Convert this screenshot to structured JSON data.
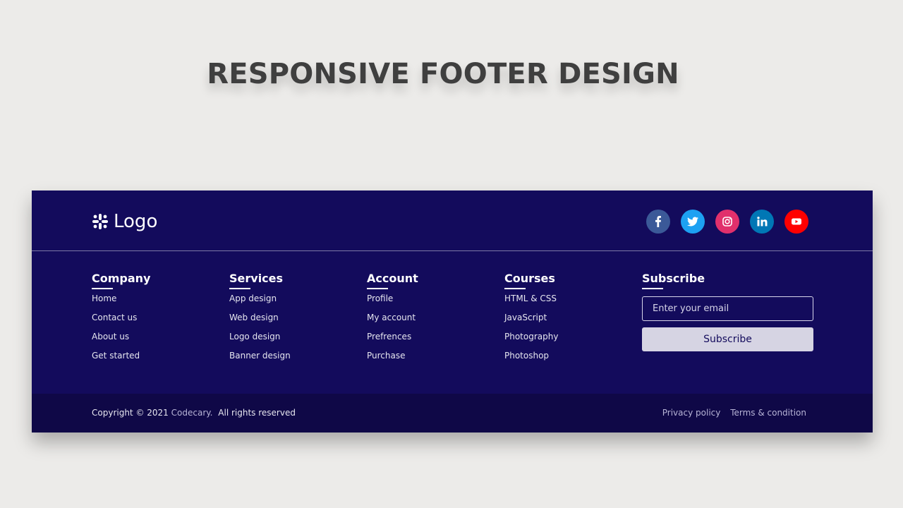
{
  "page": {
    "title": "RESPONSIVE FOOTER DESIGN"
  },
  "footer": {
    "logo_text": "Logo",
    "logo_icon": "slack-icon",
    "social": [
      {
        "name": "facebook-icon",
        "glyph": "f",
        "color": "#3b5998"
      },
      {
        "name": "twitter-icon",
        "glyph": "twitter",
        "color": "#1da1f2"
      },
      {
        "name": "instagram-icon",
        "glyph": "instagram",
        "color": "#e1306c"
      },
      {
        "name": "linkedin-icon",
        "glyph": "in",
        "color": "#0077b5"
      },
      {
        "name": "youtube-icon",
        "glyph": "youtube",
        "color": "#ff0000"
      }
    ],
    "columns": [
      {
        "title": "Company",
        "links": [
          "Home",
          "Contact us",
          "About us",
          "Get started"
        ]
      },
      {
        "title": "Services",
        "links": [
          "App design",
          "Web design",
          "Logo design",
          "Banner design"
        ]
      },
      {
        "title": "Account",
        "links": [
          "Profile",
          "My account",
          "Prefrences",
          "Purchase"
        ]
      },
      {
        "title": "Courses",
        "links": [
          "HTML & CSS",
          "JavaScript",
          "Photography",
          "Photoshop"
        ]
      }
    ],
    "subscribe": {
      "title": "Subscribe",
      "placeholder": "Enter your email",
      "button_label": "Subscribe"
    },
    "bottom": {
      "copyright_prefix": "Copyright © 2021",
      "brand": "Codecary.",
      "copyright_suffix": "All rights reserved",
      "links": [
        "Privacy policy",
        "Terms & condition"
      ]
    },
    "colors": {
      "background": "#130b5c",
      "bottom_bar": "#0f0847",
      "accent": "#d6d4e3"
    }
  }
}
